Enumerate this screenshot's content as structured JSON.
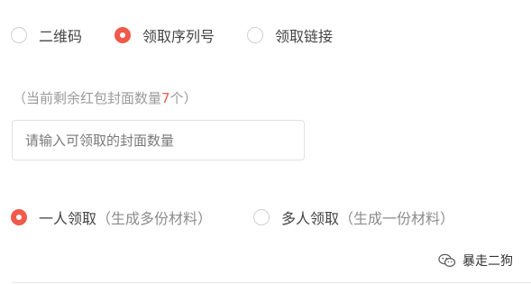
{
  "type_options": [
    {
      "label": "二维码",
      "selected": false
    },
    {
      "label": "领取序列号",
      "selected": true
    },
    {
      "label": "领取链接",
      "selected": false
    }
  ],
  "remaining_hint": {
    "prefix": "（当前剩余红包封面数量",
    "count": "7",
    "suffix": "个）"
  },
  "quantity_input": {
    "placeholder": "请输入可领取的封面数量",
    "value": ""
  },
  "claim_options": [
    {
      "label": "一人领取",
      "note": "（生成多份材料）",
      "selected": true
    },
    {
      "label": "多人领取",
      "note": "（生成一份材料）",
      "selected": false
    }
  ],
  "watermark": {
    "icon": "wechat-icon",
    "text": "暴走二狗"
  },
  "colors": {
    "accent": "#ef5a4a",
    "border": "#cfcfcf",
    "hint_text": "#9a9a9a"
  }
}
